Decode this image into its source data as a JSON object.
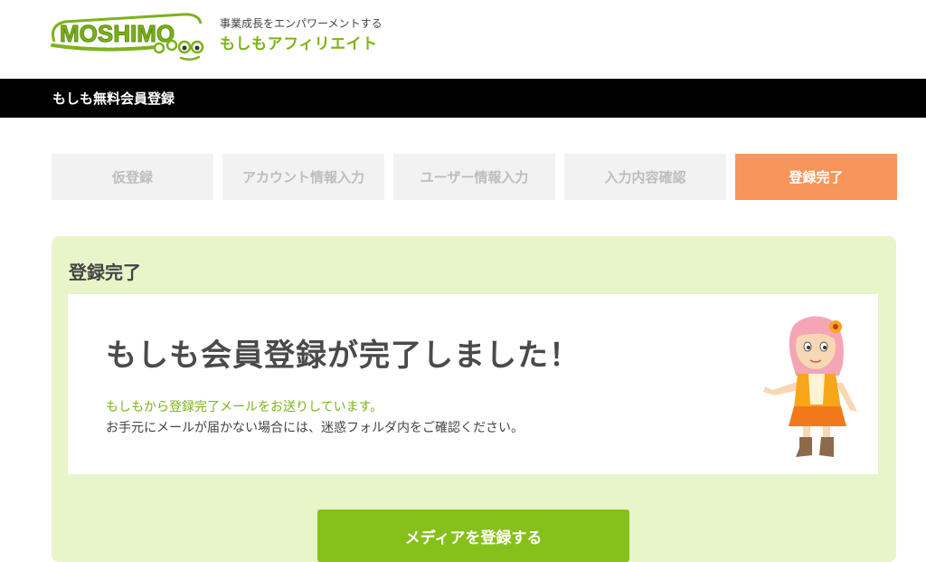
{
  "header": {
    "logo_text": "MOSHIMO",
    "tagline": "事業成長をエンパワーメントする",
    "brand": "もしもアフィリエイト"
  },
  "titlebar": {
    "title": "もしも無料会員登録"
  },
  "steps": [
    {
      "label": "仮登録",
      "active": false
    },
    {
      "label": "アカウント情報入力",
      "active": false
    },
    {
      "label": "ユーザー情報入力",
      "active": false
    },
    {
      "label": "入力内容確認",
      "active": false
    },
    {
      "label": "登録完了",
      "active": true
    }
  ],
  "panel": {
    "title": "登録完了",
    "headline": "もしも会員登録が完了しました！",
    "message_line1": "もしもから登録完了メールをお送りしています。",
    "message_line2": "お手元にメールが届かない場合には、迷惑フォルダ内をご確認ください。",
    "cta_label": "メディアを登録する"
  },
  "colors": {
    "brand_green": "#7cb31a",
    "button_green": "#86c01a",
    "panel_bg": "#e8f5c8",
    "active_step": "#f7955a",
    "inactive_step": "#f2f2f2"
  }
}
